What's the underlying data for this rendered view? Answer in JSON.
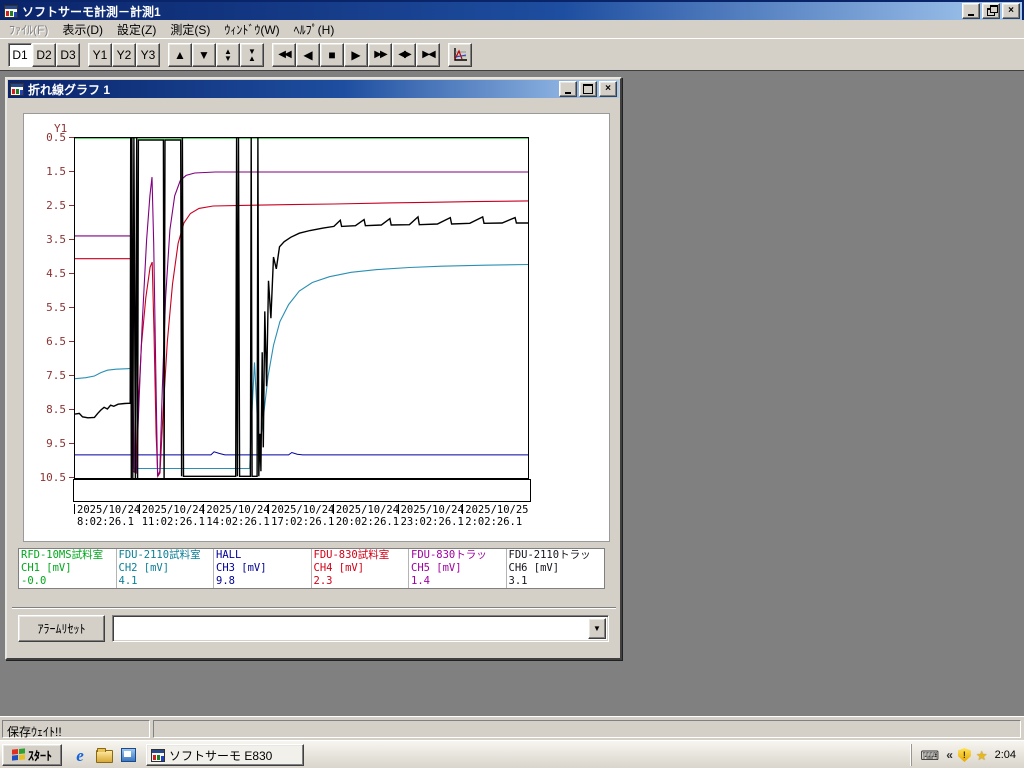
{
  "window": {
    "title": "ソフトサーモ計測－計測1"
  },
  "menu": {
    "items": [
      {
        "key": "file",
        "label": "ﾌｧｲﾙ(F)",
        "disabled": true
      },
      {
        "key": "view",
        "label": "表示(D)",
        "disabled": false
      },
      {
        "key": "settings",
        "label": "設定(Z)",
        "disabled": false
      },
      {
        "key": "measure",
        "label": "測定(S)",
        "disabled": false
      },
      {
        "key": "window",
        "label": "ｳｨﾝﾄﾞｳ(W)",
        "disabled": false
      },
      {
        "key": "help",
        "label": "ﾍﾙﾌﾟ(H)",
        "disabled": false
      }
    ]
  },
  "toolbar": {
    "d_buttons": [
      {
        "label": "D1",
        "active": true
      },
      {
        "label": "D2",
        "active": false
      },
      {
        "label": "D3",
        "active": false
      }
    ],
    "y_buttons": [
      {
        "label": "Y1",
        "active": false
      },
      {
        "label": "Y2",
        "active": false
      },
      {
        "label": "Y3",
        "active": false
      }
    ]
  },
  "chart_window": {
    "title": "折れ線グラフ 1",
    "alarm_reset_label": "ｱﾗｰﾑﾘｾｯﾄ",
    "combo_value": ""
  },
  "chart_data": {
    "type": "line",
    "title": "折れ線グラフ 1",
    "y_axis_name": "Y1",
    "y_range": [
      0.5,
      10.5
    ],
    "y_inverted": true,
    "y_ticks": [
      "0.5",
      "1.5",
      "2.5",
      "3.5",
      "4.5",
      "5.5",
      "6.5",
      "7.5",
      "8.5",
      "9.5",
      "10.5"
    ],
    "x_range_hours": [
      0,
      21.0
    ],
    "x_ticks": [
      {
        "date": "2025/10/24",
        "time": "8:02:26.1"
      },
      {
        "date": "2025/10/24",
        "time": "11:02:26.1"
      },
      {
        "date": "2025/10/24",
        "time": "14:02:26.1"
      },
      {
        "date": "2025/10/24",
        "time": "17:02:26.1"
      },
      {
        "date": "2025/10/24",
        "time": "20:02:26.1"
      },
      {
        "date": "2025/10/24",
        "time": "23:02:26.1"
      },
      {
        "date": "2025/10/25",
        "time": "2:02:26.1"
      }
    ],
    "grid": false,
    "series": [
      {
        "name": "CH1",
        "label": "RFD-10MS試料室",
        "color": "#00c014",
        "width": 1.2,
        "points": [
          [
            0,
            0.5
          ],
          [
            21,
            0.5
          ]
        ]
      },
      {
        "name": "CH3",
        "label": "HALL",
        "color": "#0000a0",
        "width": 1.0,
        "points": [
          [
            0,
            9.82
          ],
          [
            6.3,
            9.82
          ],
          [
            6.45,
            9.73
          ],
          [
            6.7,
            9.78
          ],
          [
            6.95,
            9.82
          ],
          [
            9.9,
            9.82
          ],
          [
            10.05,
            9.75
          ],
          [
            10.3,
            9.8
          ],
          [
            10.55,
            9.82
          ],
          [
            21,
            9.82
          ]
        ]
      },
      {
        "name": "CH2",
        "label": "FDU-2110試料室",
        "color": "#2a8fb4",
        "width": 1.1,
        "points": [
          [
            0,
            7.58
          ],
          [
            0.5,
            7.55
          ],
          [
            0.9,
            7.5
          ],
          [
            1.2,
            7.4
          ],
          [
            1.5,
            7.33
          ],
          [
            1.9,
            7.3
          ],
          [
            2.6,
            7.28
          ],
          [
            2.66,
            9.2
          ],
          [
            2.72,
            10.22
          ],
          [
            8.1,
            10.22
          ],
          [
            8.2,
            8.6
          ],
          [
            8.32,
            7.1
          ],
          [
            8.42,
            8.3
          ],
          [
            8.52,
            9.9
          ],
          [
            8.62,
            9.3
          ],
          [
            8.75,
            8.6
          ],
          [
            8.95,
            7.5
          ],
          [
            9.2,
            6.6
          ],
          [
            9.5,
            5.9
          ],
          [
            9.9,
            5.4
          ],
          [
            10.4,
            5.0
          ],
          [
            11,
            4.75
          ],
          [
            11.8,
            4.58
          ],
          [
            12.8,
            4.45
          ],
          [
            14,
            4.37
          ],
          [
            15.5,
            4.31
          ],
          [
            17,
            4.27
          ],
          [
            19,
            4.24
          ],
          [
            21,
            4.22
          ]
        ]
      },
      {
        "name": "CH4",
        "label": "FDU-830試料室",
        "color": "#c80020",
        "width": 1.1,
        "points": [
          [
            0,
            4.05
          ],
          [
            2.58,
            4.05
          ],
          [
            2.64,
            7.5
          ],
          [
            2.7,
            10.3
          ],
          [
            2.8,
            10.35
          ],
          [
            2.92,
            8.6
          ],
          [
            3.08,
            6.6
          ],
          [
            3.28,
            5.2
          ],
          [
            3.48,
            4.3
          ],
          [
            3.58,
            4.15
          ],
          [
            3.66,
            6.2
          ],
          [
            3.76,
            9.2
          ],
          [
            3.84,
            10.45
          ],
          [
            3.94,
            10.35
          ],
          [
            4.08,
            8.6
          ],
          [
            4.28,
            6.5
          ],
          [
            4.52,
            4.8
          ],
          [
            4.78,
            3.6
          ],
          [
            5.05,
            3.0
          ],
          [
            5.35,
            2.72
          ],
          [
            5.75,
            2.57
          ],
          [
            6.4,
            2.5
          ],
          [
            8,
            2.48
          ],
          [
            10,
            2.46
          ],
          [
            12,
            2.44
          ],
          [
            14.5,
            2.41
          ],
          [
            16.5,
            2.39
          ],
          [
            18.5,
            2.37
          ],
          [
            21,
            2.35
          ]
        ]
      },
      {
        "name": "CH5",
        "label": "FDU-830トラッ",
        "color": "#800080",
        "width": 1.1,
        "points": [
          [
            0,
            3.38
          ],
          [
            2.6,
            3.38
          ],
          [
            2.67,
            7.2
          ],
          [
            2.75,
            10.3
          ],
          [
            2.84,
            10.35
          ],
          [
            2.97,
            8.2
          ],
          [
            3.12,
            5.9
          ],
          [
            3.32,
            3.5
          ],
          [
            3.47,
            2.2
          ],
          [
            3.57,
            1.65
          ],
          [
            3.65,
            3.6
          ],
          [
            3.74,
            7.2
          ],
          [
            3.83,
            10.45
          ],
          [
            3.93,
            10.3
          ],
          [
            4.05,
            7.8
          ],
          [
            4.2,
            5.2
          ],
          [
            4.4,
            3.2
          ],
          [
            4.62,
            2.2
          ],
          [
            4.88,
            1.75
          ],
          [
            5.15,
            1.6
          ],
          [
            5.55,
            1.53
          ],
          [
            6.5,
            1.5
          ],
          [
            21,
            1.5
          ]
        ]
      },
      {
        "name": "CH6",
        "label": "FDU-2110トラッ",
        "color": "#000000",
        "width": 1.4,
        "points": [
          [
            0,
            8.62
          ],
          [
            0.2,
            8.6
          ],
          [
            0.35,
            8.7
          ],
          [
            0.6,
            8.73
          ],
          [
            0.9,
            8.72
          ],
          [
            1.05,
            8.6
          ],
          [
            1.2,
            8.5
          ],
          [
            1.35,
            8.42
          ],
          [
            1.5,
            8.47
          ],
          [
            1.65,
            8.36
          ],
          [
            1.8,
            8.39
          ],
          [
            2,
            8.33
          ],
          [
            2.3,
            8.31
          ],
          [
            2.56,
            8.3
          ],
          [
            2.58,
            0.5
          ],
          [
            2.61,
            10.5
          ],
          [
            2.64,
            0.5
          ],
          [
            2.68,
            10.5
          ],
          [
            2.73,
            0.5
          ],
          [
            2.8,
            10.5
          ],
          [
            2.86,
            0.5
          ],
          [
            2.9,
            10.5
          ],
          [
            2.94,
            0.56
          ],
          [
            4.1,
            0.56
          ],
          [
            4.13,
            10.5
          ],
          [
            4.17,
            0.56
          ],
          [
            4.9,
            0.56
          ],
          [
            4.94,
            10.45
          ],
          [
            4.98,
            0.5
          ],
          [
            5.03,
            10.45
          ],
          [
            7.45,
            10.45
          ],
          [
            7.49,
            0.5
          ],
          [
            7.53,
            10.45
          ],
          [
            7.58,
            0.5
          ],
          [
            7.63,
            10.45
          ],
          [
            8.13,
            10.45
          ],
          [
            8.17,
            0.5
          ],
          [
            8.21,
            10.45
          ],
          [
            8.44,
            10.45
          ],
          [
            8.48,
            0.5
          ],
          [
            8.52,
            10.45
          ],
          [
            8.58,
            9.2
          ],
          [
            8.62,
            10.3
          ],
          [
            8.68,
            6.8
          ],
          [
            8.73,
            9.6
          ],
          [
            8.8,
            5.6
          ],
          [
            8.88,
            7.8
          ],
          [
            8.97,
            4.7
          ],
          [
            9.08,
            5.8
          ],
          [
            9.2,
            4.0
          ],
          [
            9.33,
            4.35
          ],
          [
            9.48,
            3.7
          ],
          [
            9.7,
            3.55
          ],
          [
            10,
            3.42
          ],
          [
            10.4,
            3.3
          ],
          [
            10.9,
            3.22
          ],
          [
            11.5,
            3.15
          ],
          [
            12,
            3.1
          ],
          [
            12.3,
            2.92
          ],
          [
            12.36,
            3.1
          ],
          [
            13,
            3.08
          ],
          [
            13.4,
            2.9
          ],
          [
            13.46,
            3.08
          ],
          [
            14.2,
            3.06
          ],
          [
            14.6,
            2.87
          ],
          [
            14.66,
            3.06
          ],
          [
            15.5,
            3.05
          ],
          [
            15.9,
            2.82
          ],
          [
            15.96,
            3.05
          ],
          [
            16.8,
            3.03
          ],
          [
            17.4,
            2.84
          ],
          [
            17.46,
            3.03
          ],
          [
            18.3,
            3.01
          ],
          [
            18.9,
            2.82
          ],
          [
            18.96,
            3.01
          ],
          [
            19.8,
            3.0
          ],
          [
            20.4,
            2.84
          ],
          [
            20.46,
            3.0
          ],
          [
            21,
            3.0
          ]
        ]
      }
    ]
  },
  "legend": {
    "channels": [
      {
        "name": "RFD-10MS試料室",
        "channel": "CH1 [mV]",
        "value": "-0.0",
        "color": "#00a81c"
      },
      {
        "name": "FDU-2110試料室",
        "channel": "CH2 [mV]",
        "value": "4.1",
        "color": "#0b7f96"
      },
      {
        "name": "HALL",
        "channel": "CH3 [mV]",
        "value": "9.8",
        "color": "#000096"
      },
      {
        "name": "FDU-830試料室",
        "channel": "CH4 [mV]",
        "value": "2.3",
        "color": "#d40017"
      },
      {
        "name": "FDU-830トラッ",
        "channel": "CH5 [mV]",
        "value": "1.4",
        "color": "#a000a0"
      },
      {
        "name": "FDU-2110トラッ",
        "channel": "CH6 [mV]",
        "value": "3.1",
        "color": "#14141e"
      }
    ]
  },
  "status_bar": {
    "message": "保存ｳｪｲﾄ!!"
  },
  "taskbar": {
    "start_label": "ｽﾀｰﾄ",
    "task_label": "ソフトサーモ E830",
    "clock": "2:04"
  }
}
